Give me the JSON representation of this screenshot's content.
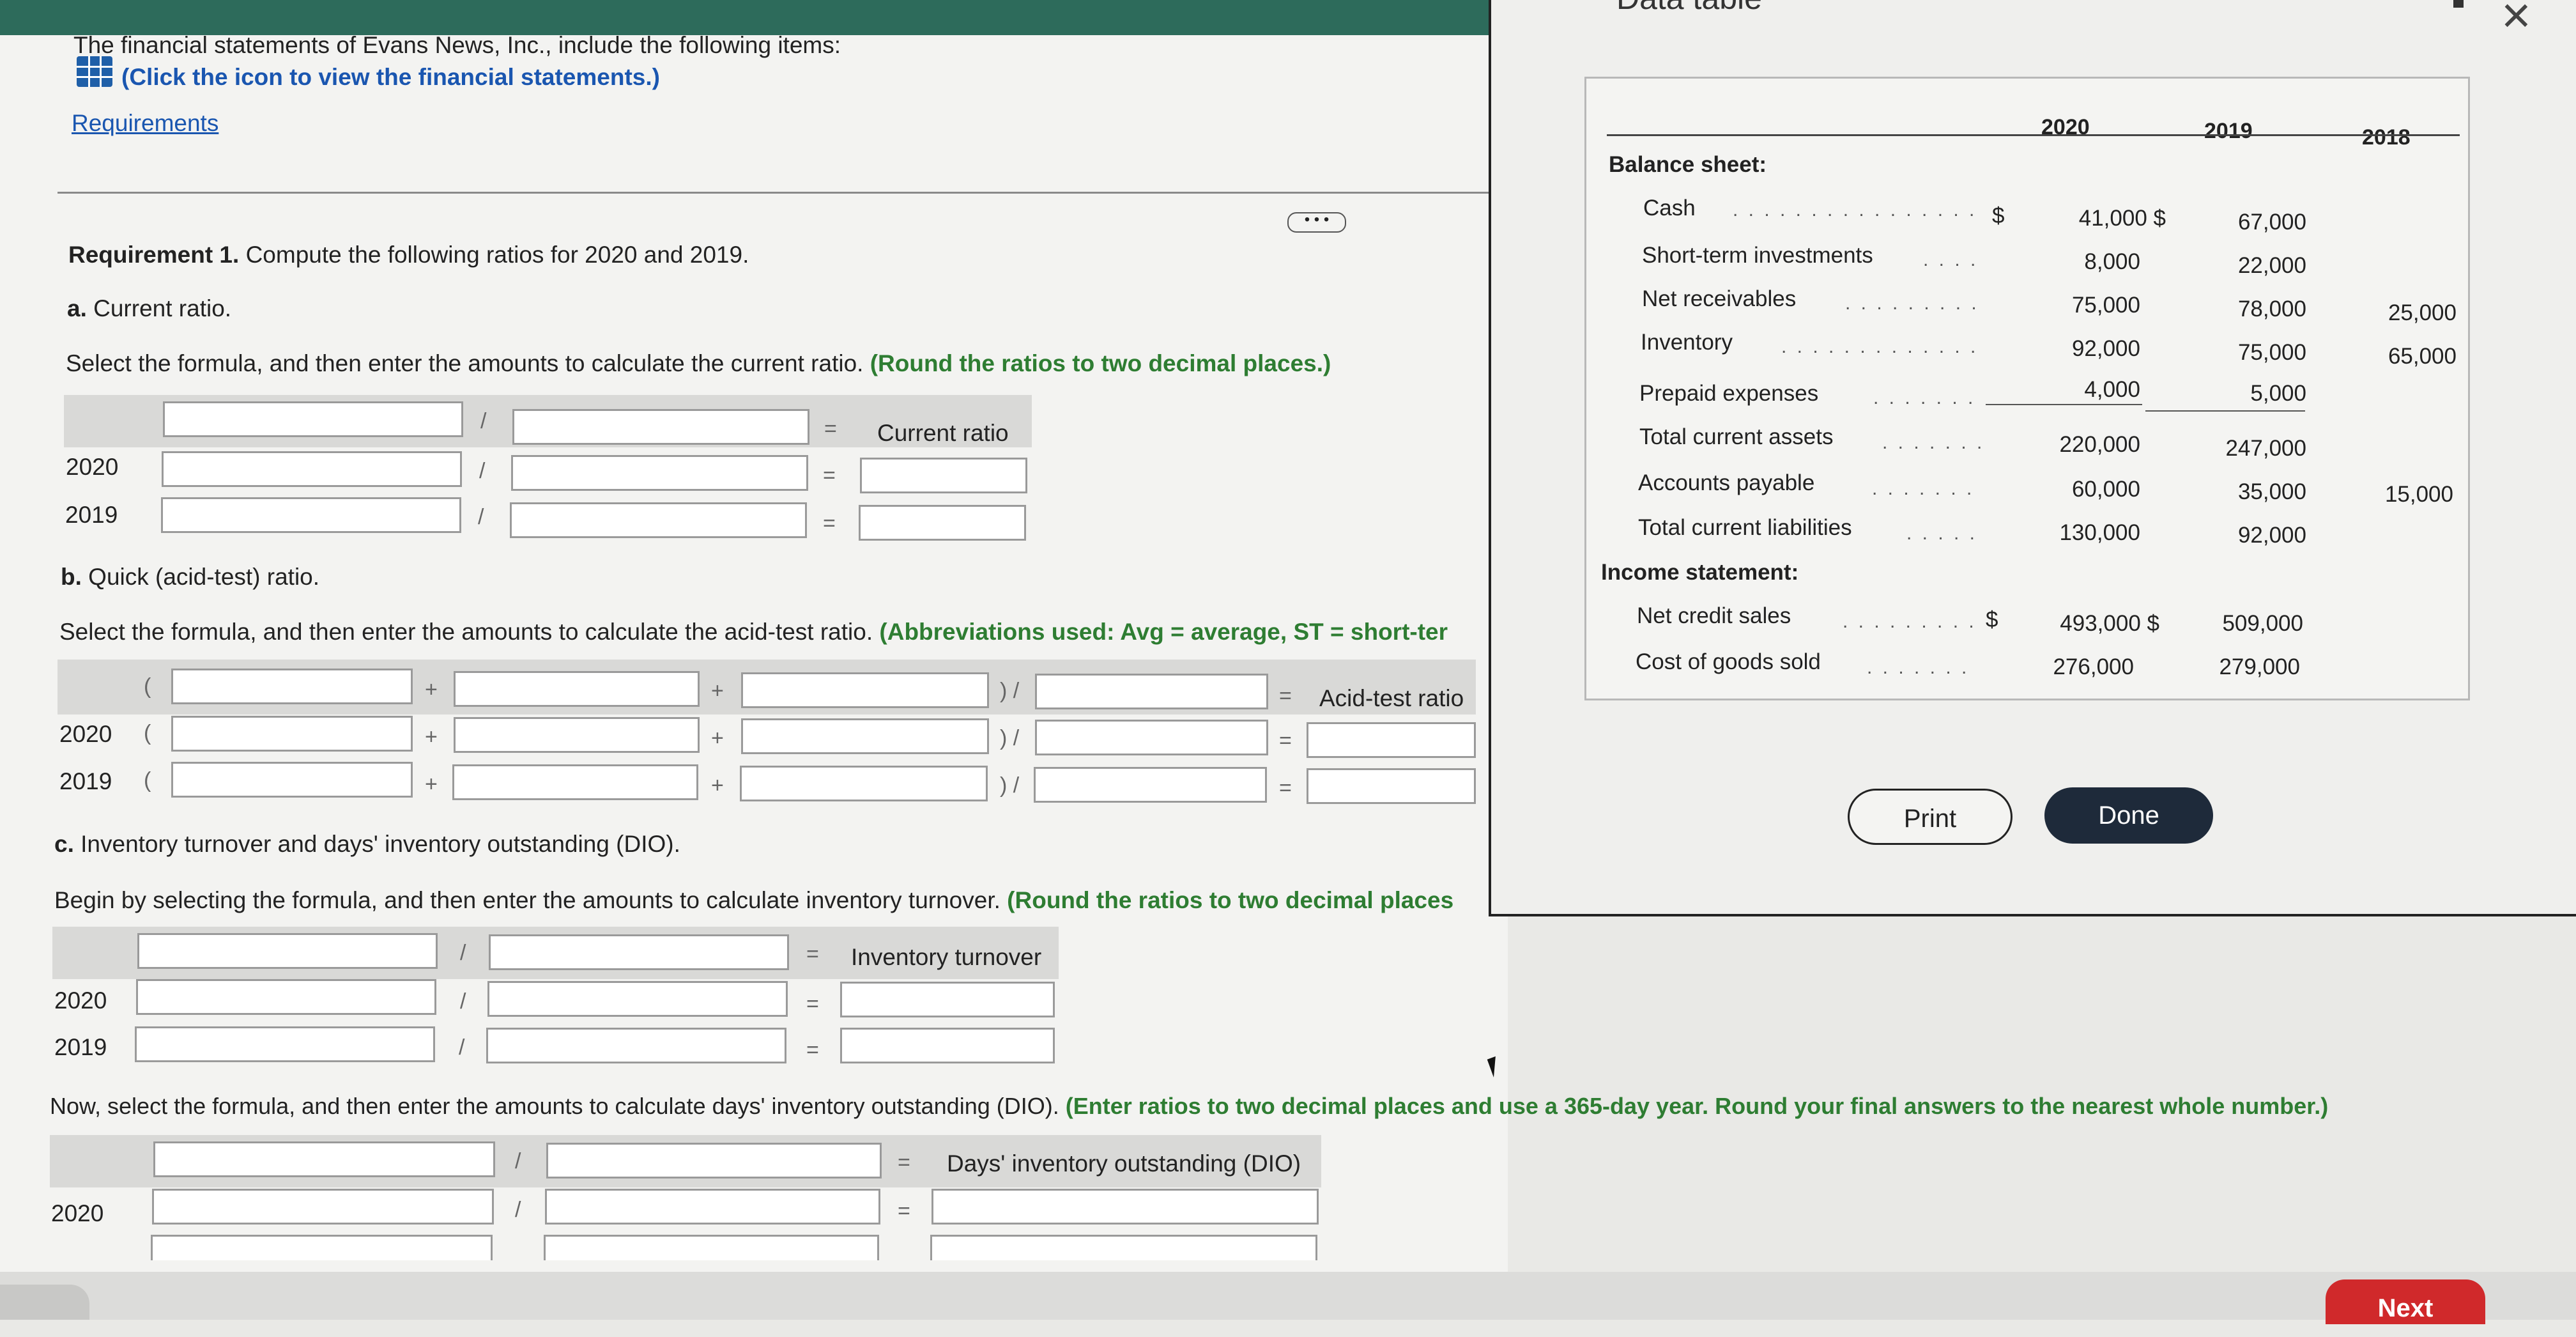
{
  "intro": {
    "statement": "The financial statements of Evans News, Inc., include the following items:",
    "icon_link": "(Click the icon to view the financial statements.)",
    "requirements_link": "Requirements",
    "more_button": "• • •"
  },
  "req1": {
    "heading_bold": "Requirement 1.",
    "heading_rest": " Compute the following ratios for 2020 and 2019."
  },
  "part_a": {
    "title_bold": "a.",
    "title_rest": " Current ratio.",
    "instruction": "Select the formula, and then enter the amounts to calculate the current ratio. ",
    "instruction_green": "(Round the ratios to two decimal places.)",
    "result_label": "Current ratio",
    "years": [
      "2020",
      "2019"
    ]
  },
  "part_b": {
    "title_bold": "b.",
    "title_rest": " Quick (acid-test) ratio.",
    "instruction": "Select the formula, and then enter the amounts to calculate the acid-test ratio. ",
    "instruction_green": "(Abbreviations used: Avg = average, ST = short-ter",
    "result_label": "Acid-test ratio",
    "years": [
      "2020",
      "2019"
    ]
  },
  "part_c": {
    "title_bold": "c.",
    "title_rest": " Inventory turnover and days' inventory outstanding (DIO).",
    "instruction": "Begin by selecting the formula, and then enter the amounts to calculate inventory turnover. ",
    "instruction_green": "(Round the ratios to two decimal places",
    "result_label": "Inventory turnover",
    "years": [
      "2020",
      "2019"
    ],
    "dio_instruction": "Now, select the formula, and then enter the amounts to calculate days' inventory outstanding (DIO). ",
    "dio_instruction_green": "(Enter ratios to two decimal places and use a 365-day year. Round your final answers to the nearest whole number.)",
    "dio_result_label": "Days' inventory outstanding (DIO)",
    "dio_year": "2020"
  },
  "symbols": {
    "divide": "/",
    "equals": "=",
    "plus": "+",
    "open_paren": "(",
    "close_div": ") /"
  },
  "dialog": {
    "title": "Data table",
    "columns": [
      "2020",
      "2019",
      "2018"
    ],
    "balance_heading": "Balance sheet:",
    "income_heading": "Income statement:",
    "rows": [
      {
        "label": "Cash",
        "dollar": "$",
        "v2020": "41,000 $",
        "v2019": "67,000",
        "v2018": ""
      },
      {
        "label": "Short-term investments",
        "dollar": "",
        "v2020": "8,000",
        "v2019": "22,000",
        "v2018": ""
      },
      {
        "label": "Net receivables",
        "dollar": "",
        "v2020": "75,000",
        "v2019": "78,000",
        "v2018": "25,000"
      },
      {
        "label": "Inventory",
        "dollar": "",
        "v2020": "92,000",
        "v2019": "75,000",
        "v2018": "65,000"
      },
      {
        "label": "Prepaid expenses",
        "dollar": "",
        "v2020": "4,000",
        "v2019": "5,000",
        "v2018": ""
      },
      {
        "label": "Total current assets",
        "dollar": "",
        "v2020": "220,000",
        "v2019": "247,000",
        "v2018": ""
      },
      {
        "label": "Accounts payable",
        "dollar": "",
        "v2020": "60,000",
        "v2019": "35,000",
        "v2018": "15,000"
      },
      {
        "label": "Total current liabilities",
        "dollar": "",
        "v2020": "130,000",
        "v2019": "92,000",
        "v2018": ""
      }
    ],
    "income_rows": [
      {
        "label": "Net credit sales",
        "dollar": "$",
        "v2020": "493,000 $",
        "v2019": "509,000"
      },
      {
        "label": "Cost of goods sold",
        "dollar": "",
        "v2020": "276,000",
        "v2019": "279,000"
      }
    ],
    "print_label": "Print",
    "done_label": "Done"
  },
  "footer": {
    "next_label": "Next"
  },
  "colors": {
    "accent_green": "#2e7d32",
    "link_blue": "#1a56b0",
    "done_bg": "#1e2a3a",
    "next_red": "#d0292b",
    "topbar": "#2d6b5b"
  }
}
